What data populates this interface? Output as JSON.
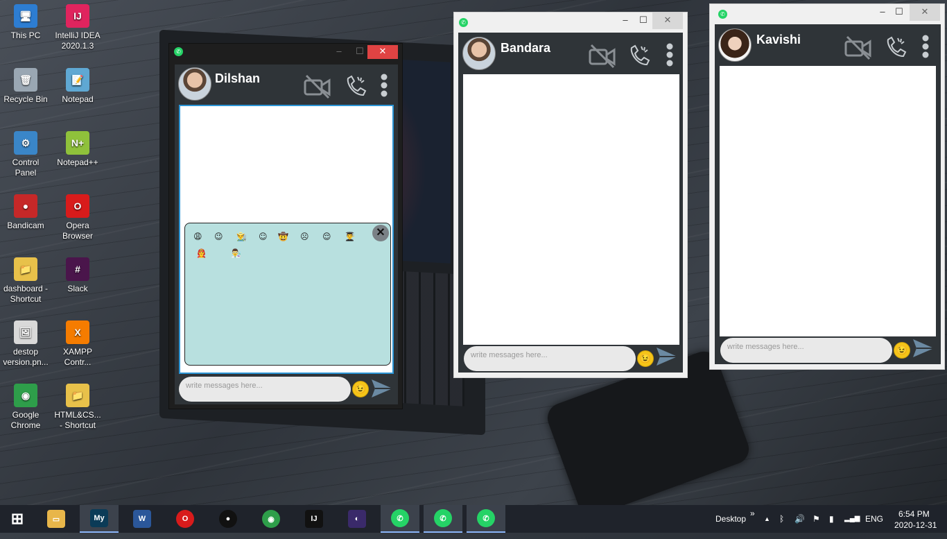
{
  "desktop_icons": [
    {
      "label": "This PC",
      "glyph": "🖥",
      "color": "#2d7dd2"
    },
    {
      "label": "IntelliJ IDEA\n2020.1.3",
      "glyph": "IJ",
      "color": "#e0245e"
    },
    {
      "label": "Recycle Bin",
      "glyph": "🗑",
      "color": "#9aa7b3"
    },
    {
      "label": "Notepad",
      "glyph": "📝",
      "color": "#5fa8d3"
    },
    {
      "label": "Control\nPanel",
      "glyph": "⚙",
      "color": "#3a86c8"
    },
    {
      "label": "Notepad++",
      "glyph": "N+",
      "color": "#8fc13b"
    },
    {
      "label": "Bandicam",
      "glyph": "●",
      "color": "#c62828"
    },
    {
      "label": "Opera\nBrowser",
      "glyph": "O",
      "color": "#d81b1b"
    },
    {
      "label": "dashboard -\nShortcut",
      "glyph": "📁",
      "color": "#e8c14a"
    },
    {
      "label": "Slack",
      "glyph": "#",
      "color": "#4a154b"
    },
    {
      "label": "destop\nversion.pn...",
      "glyph": "🖼",
      "color": "#d9d9d9"
    },
    {
      "label": "XAMPP\nContr...",
      "glyph": "X",
      "color": "#f57c00"
    },
    {
      "label": "Google\nChrome",
      "glyph": "◉",
      "color": "#2e9e4a"
    },
    {
      "label": "HTML&CS...\n- Shortcut",
      "glyph": "📁",
      "color": "#e8c14a"
    }
  ],
  "chat_windows": [
    {
      "contact": "Dilshan",
      "placeholder": "write messages here...",
      "emoji_panel_open": true,
      "emojis": [
        "😩",
        "😉",
        "👨‍🌾",
        "☺",
        "🤠",
        "☹",
        "😌",
        "👨‍🎓",
        "👨‍🚒",
        "👨‍🔬"
      ]
    },
    {
      "contact": "Bandara",
      "placeholder": "write messages here...",
      "emoji_panel_open": false
    },
    {
      "contact": "Kavishi",
      "placeholder": "write messages here...",
      "emoji_panel_open": false
    }
  ],
  "taskbar": {
    "apps": [
      "start-icon",
      "file-explorer-icon",
      "mysql-icon",
      "word-icon",
      "opera-icon",
      "bandicam-icon",
      "chrome-icon",
      "intellij-icon",
      "eclipse-icon",
      "whatsapp-icon",
      "whatsapp-icon",
      "whatsapp-icon"
    ],
    "desktop_label": "Desktop",
    "chevron": "»",
    "language": "ENG",
    "time": "6:54 PM",
    "date": "2020-12-31"
  },
  "colors": {
    "chat_bg": "#2f3438",
    "emoji_panel": "#b8e0df",
    "whatsapp_green": "#25d366",
    "close_red": "#e04343"
  }
}
